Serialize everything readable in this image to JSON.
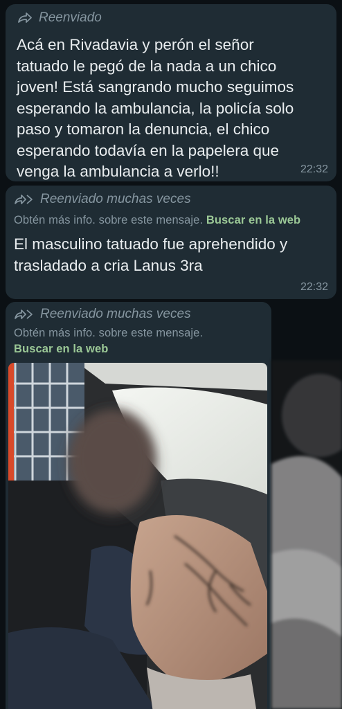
{
  "messages": [
    {
      "forward_label": "Reenviado",
      "text": "Acá en Rivadavia y perón el señor\ntatuado le pegó de la nada a un chico\njoven! Está sangrando mucho seguimos\nesperando la ambulancia, la policía solo\npaso y tomaron la denuncia, el chico\nesperando todavía en la papelera que\nvenga la ambulancia a verlo!!",
      "time": "22:32"
    },
    {
      "forward_label": "Reenviado muchas veces",
      "info_text": "Obtén más info. sobre este mensaje.",
      "info_link": "Buscar en la web",
      "text": "El masculino tatuado fue aprehendido y\ntrasladado a cria Lanus 3ra",
      "time": "22:32"
    },
    {
      "forward_label": "Reenviado muchas veces",
      "info_text": "Obtén más info. sobre este mensaje.",
      "info_link": "Buscar en la web",
      "has_photo": true
    }
  ],
  "icons": {
    "forward": "forward-arrow-icon",
    "forward_many": "forward-many-icon"
  },
  "colors": {
    "background": "#0b1014",
    "bubble": "#1f2c34",
    "text": "#e9edef",
    "meta": "#8696a0",
    "link": "#9bc896"
  }
}
